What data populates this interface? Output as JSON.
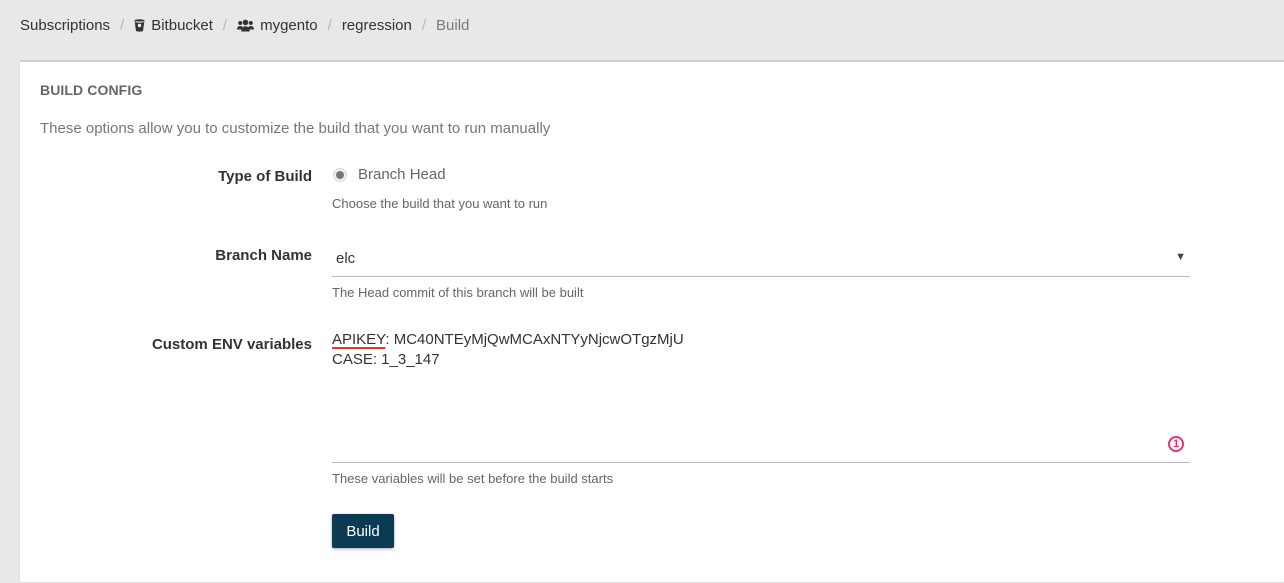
{
  "breadcrumb": {
    "items": [
      {
        "label": "Subscriptions",
        "icon": ""
      },
      {
        "label": "Bitbucket",
        "icon": "bitbucket-icon"
      },
      {
        "label": "mygento",
        "icon": "users-icon"
      },
      {
        "label": "regression",
        "icon": ""
      },
      {
        "label": "Build",
        "icon": ""
      }
    ],
    "separator": "/"
  },
  "card": {
    "title": "BUILD CONFIG",
    "description": "These options allow you to customize the build that you want to run manually"
  },
  "form": {
    "type_of_build": {
      "label": "Type of Build",
      "option": "Branch Head",
      "help": "Choose the build that you want to run"
    },
    "branch_name": {
      "label": "Branch Name",
      "value": "elc",
      "help": "The Head commit of this branch will be built"
    },
    "env_vars": {
      "label": "Custom ENV variables",
      "line1_key": "APIKEY",
      "line1_rest": ": MC40NTEyMjQwMCAxNTYyNjcwOTgzMjU",
      "line2": "CASE: 1_3_147",
      "counter": "1",
      "help": "These variables will be set before the build starts"
    },
    "build_button": "Build"
  },
  "colors": {
    "button_bg": "#0b3b52",
    "error_accent": "#e2337a",
    "spell_underline": "#e2342d"
  }
}
